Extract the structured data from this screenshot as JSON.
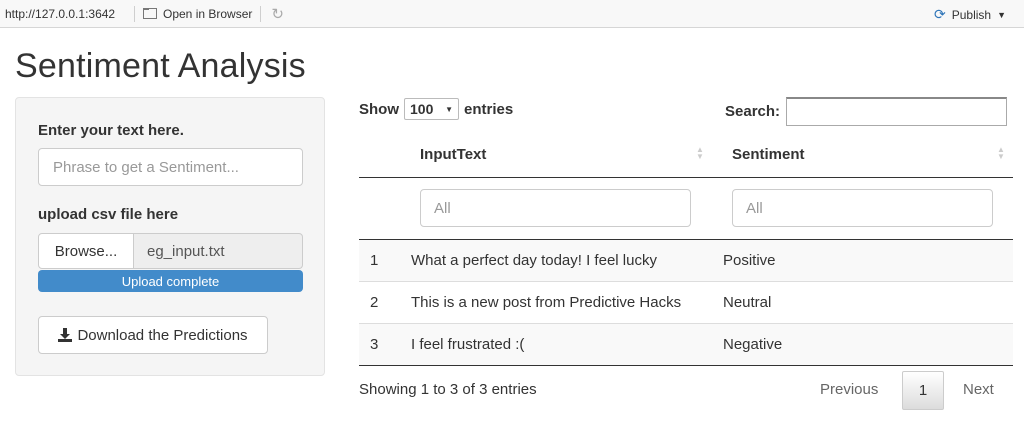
{
  "toolbar": {
    "url": "http://127.0.0.1:3642",
    "open_in_browser": "Open in Browser",
    "publish": "Publish"
  },
  "app": {
    "title": "Sentiment Analysis"
  },
  "sidebar": {
    "text_label": "Enter your text here.",
    "text_placeholder": "Phrase to get a Sentiment...",
    "file_label": "upload csv file here",
    "browse_label": "Browse...",
    "file_name": "eg_input.txt",
    "progress_label": "Upload complete",
    "progress_value": 1.0,
    "download_label": "Download the Predictions"
  },
  "table": {
    "show_label": "Show",
    "length_value": "100",
    "entries_label": "entries",
    "search_label": "Search:",
    "columns": [
      "InputText",
      "Sentiment"
    ],
    "filter_placeholders": [
      "All",
      "All"
    ],
    "rows": [
      {
        "index": "1",
        "text": "What a perfect day today! I feel lucky",
        "sentiment": "Positive"
      },
      {
        "index": "2",
        "text": "This is a new post from Predictive Hacks",
        "sentiment": "Neutral"
      },
      {
        "index": "3",
        "text": "I feel frustrated :(",
        "sentiment": "Negative"
      }
    ],
    "info": "Showing 1 to 3 of 3 entries",
    "pagination": {
      "previous": "Previous",
      "current": "1",
      "next": "Next"
    }
  },
  "colors": {
    "accent": "#428bca",
    "publish_icon": "#2d74b8"
  }
}
